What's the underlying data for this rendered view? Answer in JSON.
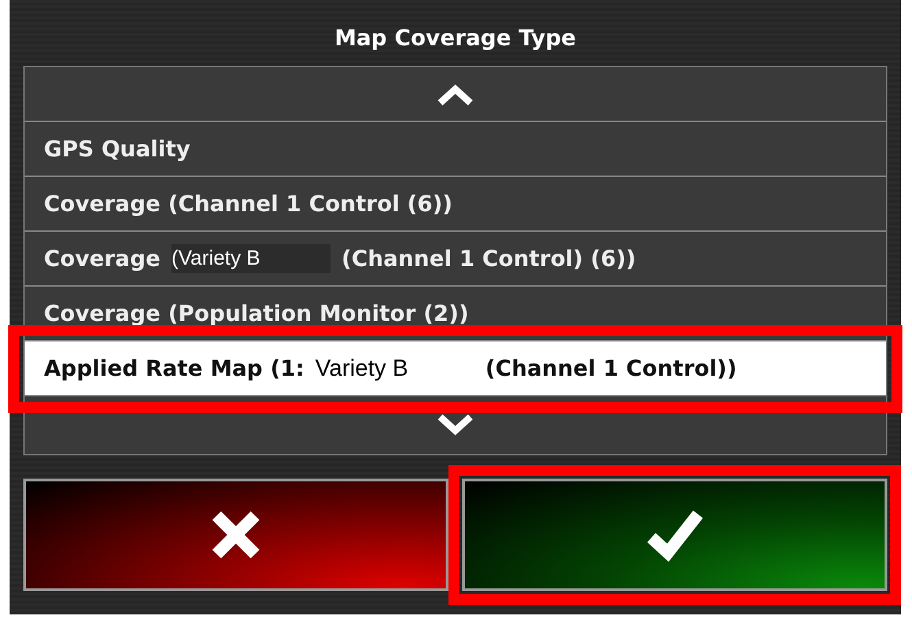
{
  "dialog": {
    "title": "Map Coverage Type",
    "list": {
      "items": [
        {
          "label": "GPS Quality",
          "selected": false
        },
        {
          "label": "Coverage (Channel 1 Control (6))",
          "selected": false
        },
        {
          "label": "Coverage",
          "redaction": "(Variety B",
          "suffix": "(Channel 1 Control) (6))",
          "selected": false
        },
        {
          "label": "Coverage (Population Monitor (2))",
          "selected": false
        },
        {
          "label": "Applied Rate Map (1:",
          "redaction": "Variety B",
          "suffix": "(Channel 1 Control))",
          "selected": true
        }
      ]
    },
    "buttons": [
      {
        "kind": "cancel",
        "highlighted": false
      },
      {
        "kind": "confirm",
        "highlighted": true
      }
    ]
  }
}
